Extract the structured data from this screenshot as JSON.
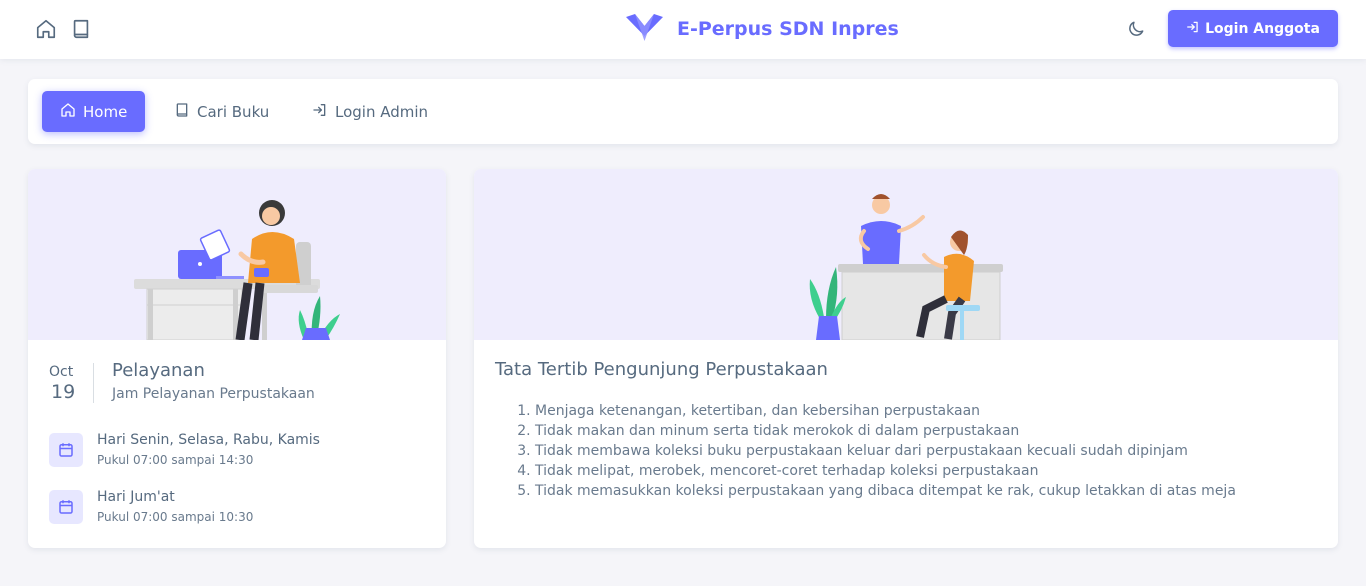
{
  "app": {
    "brand_title": "E-Perpus SDN Inpres",
    "login_button": "Login Anggota",
    "accent_color": "#696cff"
  },
  "nav": {
    "items": [
      {
        "label": "Home",
        "icon": "home-icon",
        "active": true
      },
      {
        "label": "Cari Buku",
        "icon": "book-icon",
        "active": false
      },
      {
        "label": "Login Admin",
        "icon": "login-icon",
        "active": false
      }
    ]
  },
  "service_card": {
    "date_month": "Oct",
    "date_day": "19",
    "title": "Pelayanan",
    "subtitle": "Jam Pelayanan Perpustakaan",
    "schedule": [
      {
        "days": "Hari Senin, Selasa, Rabu, Kamis",
        "time": "Pukul 07:00 sampai 14:30"
      },
      {
        "days": "Hari Jum'at",
        "time": "Pukul 07:00 sampai 10:30"
      }
    ]
  },
  "rules_card": {
    "title": "Tata Tertib Pengunjung Perpustakaan",
    "rules": [
      "Menjaga ketenangan, ketertiban, dan kebersihan perpustakaan",
      "Tidak makan dan minum serta tidak merokok di dalam perpustakaan",
      "Tidak membawa koleksi buku perpustakaan keluar dari perpustakaan kecuali sudah dipinjam",
      "Tidak melipat, merobek, mencoret-coret terhadap koleksi perpustakaan",
      "Tidak memasukkan koleksi perpustakaan yang dibaca ditempat ke rak, cukup letakkan di atas meja"
    ]
  }
}
